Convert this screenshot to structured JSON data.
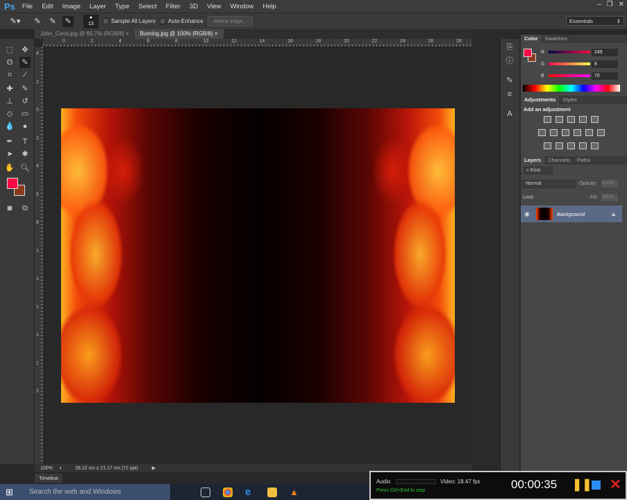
{
  "app": {
    "logo": "Ps",
    "menu": [
      "File",
      "Edit",
      "Image",
      "Layer",
      "Type",
      "Select",
      "Filter",
      "3D",
      "View",
      "Window",
      "Help"
    ],
    "window_controls": [
      "–",
      "❐",
      "✕"
    ]
  },
  "options": {
    "brush_size": "13",
    "sample_all_layers": "Sample All Layers",
    "auto_enhance": "Auto-Enhance",
    "refine_edge": "Refine Edge...",
    "workspace": "Essentials"
  },
  "tabs": [
    {
      "label": "John_Cena.jpg @ 66.7% (RGB/8)",
      "close": "×"
    },
    {
      "label": "Burning.jpg @ 100% (RGB/8)",
      "close": "×"
    }
  ],
  "ruler": {
    "h": [
      "0",
      "2",
      "4",
      "6",
      "8",
      "10",
      "12",
      "14",
      "16",
      "18",
      "20",
      "22",
      "24",
      "26",
      "28"
    ],
    "v": [
      "4",
      "2",
      "0",
      "2",
      "4",
      "6",
      "8",
      "1",
      "1",
      "1",
      "1",
      "1",
      "2"
    ]
  },
  "status": {
    "zoom": "100%",
    "doc_size": "28.22 cm x 21.17 cm (72 ppi)",
    "arrow": "▶"
  },
  "timeline": "Timeline",
  "color_panel": {
    "tabs": [
      "Color",
      "Swatches"
    ],
    "r_label": "R",
    "g_label": "G",
    "b_label": "B",
    "r": "249",
    "g": "8",
    "b": "70",
    "fg": "#f90846",
    "bg": "#8b3a1e"
  },
  "adjustments": {
    "tabs": [
      "Adjustments",
      "Styles"
    ],
    "heading": "Add an adjustment"
  },
  "layers": {
    "tabs": [
      "Layers",
      "Channels",
      "Paths"
    ],
    "filter": "Kind",
    "blend": "Normal",
    "opacity_label": "Opacity:",
    "opacity": "100%",
    "lock_label": "Lock:",
    "fill_label": "Fill:",
    "fill": "100%",
    "layer_name": "Background"
  },
  "taskbar": {
    "search": "Search the web and Windows"
  },
  "recorder": {
    "audio": "Audio",
    "video": "Video: 18.47 fps",
    "hint": "Press Ctrl+End to stop",
    "time": "00:00:35"
  }
}
